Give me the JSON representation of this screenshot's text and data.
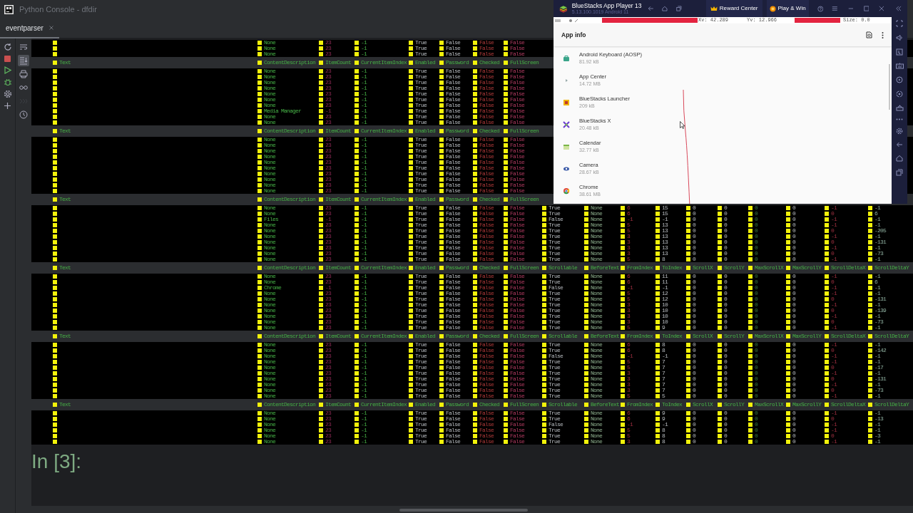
{
  "window": {
    "title": "Python Console - dfdir"
  },
  "tabs": [
    {
      "label": "eventparser",
      "selected": true
    }
  ],
  "console_toolbar": [
    {
      "kind": "wrap",
      "selected": false,
      "disabled": false
    },
    {
      "kind": "scroll-end",
      "selected": true,
      "disabled": false
    },
    {
      "kind": "print",
      "selected": false,
      "disabled": false
    },
    {
      "kind": "glasses",
      "selected": false,
      "disabled": false
    },
    {
      "kind": "history",
      "selected": false,
      "disabled": true
    },
    {
      "kind": "clock",
      "selected": false,
      "disabled": false
    }
  ],
  "console": {
    "blocks": [
      {
        "rows": [
          [
            "",
            "None",
            "23",
            "-1",
            "True",
            "False",
            "False",
            "False"
          ],
          [
            "",
            "None",
            "23",
            "-1",
            "True",
            "False",
            "False",
            "False"
          ],
          [
            "",
            "None",
            "23",
            "-1",
            "True",
            "False",
            "False",
            "False"
          ]
        ]
      },
      {
        "columns": [
          "Text",
          "ContentDescription",
          "ItemCount",
          "CurrentItemIndex",
          "Enabled",
          "Password",
          "Checked",
          "FullScreen"
        ],
        "rows": [
          [
            "",
            "None",
            "23",
            "-1",
            "True",
            "False",
            "False",
            "False"
          ],
          [
            "",
            "None",
            "23",
            "-1",
            "True",
            "False",
            "False",
            "False"
          ],
          [
            "",
            "None",
            "23",
            "-1",
            "True",
            "False",
            "False",
            "False"
          ],
          [
            "",
            "None",
            "23",
            "-1",
            "True",
            "False",
            "False",
            "False"
          ],
          [
            "",
            "None",
            "23",
            "-1",
            "True",
            "False",
            "False",
            "False"
          ],
          [
            "",
            "None",
            "23",
            "-1",
            "True",
            "False",
            "False",
            "False"
          ],
          [
            "",
            "None",
            "23",
            "-1",
            "True",
            "False",
            "False",
            "False"
          ],
          [
            "",
            "Media Manager",
            "-1",
            "-1",
            "True",
            "False",
            "False",
            "False"
          ],
          [
            "",
            "None",
            "23",
            "-1",
            "True",
            "False",
            "False",
            "False"
          ],
          [
            "",
            "None",
            "23",
            "-1",
            "True",
            "False",
            "False",
            "False"
          ]
        ]
      },
      {
        "columns": [
          "Text",
          "ContentDescription",
          "ItemCount",
          "CurrentItemIndex",
          "Enabled",
          "Password",
          "Checked",
          "FullScreen"
        ],
        "rows": [
          [
            "",
            "None",
            "23",
            "-1",
            "True",
            "False",
            "False",
            "False"
          ],
          [
            "",
            "None",
            "23",
            "-1",
            "True",
            "False",
            "False",
            "False"
          ],
          [
            "",
            "None",
            "23",
            "-1",
            "True",
            "False",
            "False",
            "False"
          ],
          [
            "",
            "None",
            "23",
            "-1",
            "True",
            "False",
            "False",
            "False"
          ],
          [
            "",
            "None",
            "23",
            "-1",
            "True",
            "False",
            "False",
            "False"
          ],
          [
            "",
            "None",
            "23",
            "-1",
            "True",
            "False",
            "False",
            "False"
          ],
          [
            "",
            "None",
            "23",
            "-1",
            "True",
            "False",
            "False",
            "False"
          ],
          [
            "",
            "None",
            "23",
            "-1",
            "True",
            "False",
            "False",
            "False"
          ],
          [
            "",
            "None",
            "23",
            "-1",
            "True",
            "False",
            "False",
            "False"
          ],
          [
            "",
            "None",
            "23",
            "-1",
            "True",
            "False",
            "False",
            "False"
          ]
        ]
      },
      {
        "columns": [
          "Text",
          "ContentDescription",
          "ItemCount",
          "CurrentItemIndex",
          "Enabled",
          "Password",
          "Checked",
          "FullScreen"
        ],
        "rows": [
          [
            "",
            "None",
            "23",
            "-1",
            "True",
            "False",
            "False",
            "False",
            "True",
            "None",
            "6",
            "15",
            "0",
            "0",
            "0",
            "0",
            "-1",
            "-1"
          ],
          [
            "",
            "None",
            "23",
            "-1",
            "True",
            "False",
            "False",
            "False",
            "True",
            "None",
            "6",
            "15",
            "0",
            "0",
            "0",
            "0",
            "0",
            "6"
          ],
          [
            "",
            "Files",
            "-1",
            "-1",
            "True",
            "False",
            "False",
            "False",
            "False",
            "None",
            "-1",
            "-1",
            "0",
            "0",
            "0",
            "0",
            "-1",
            "-1"
          ],
          [
            "",
            "None",
            "23",
            "-1",
            "True",
            "False",
            "False",
            "False",
            "True",
            "None",
            "5",
            "13",
            "0",
            "0",
            "0",
            "0",
            "-1",
            "-1"
          ],
          [
            "",
            "None",
            "23",
            "-1",
            "True",
            "False",
            "False",
            "False",
            "True",
            "None",
            "5",
            "13",
            "0",
            "0",
            "0",
            "0",
            "0",
            "-205"
          ],
          [
            "",
            "None",
            "23",
            "-1",
            "True",
            "False",
            "False",
            "False",
            "True",
            "None",
            "3",
            "13",
            "0",
            "0",
            "0",
            "0",
            "-1",
            "-1"
          ],
          [
            "",
            "None",
            "23",
            "-1",
            "True",
            "False",
            "False",
            "False",
            "True",
            "None",
            "3",
            "13",
            "0",
            "0",
            "0",
            "0",
            "0",
            "-131"
          ],
          [
            "",
            "None",
            "23",
            "-1",
            "True",
            "False",
            "False",
            "False",
            "True",
            "None",
            "3",
            "13",
            "0",
            "0",
            "0",
            "0",
            "-1",
            "-1"
          ],
          [
            "",
            "None",
            "23",
            "-1",
            "True",
            "False",
            "False",
            "False",
            "True",
            "None",
            "3",
            "13",
            "0",
            "0",
            "0",
            "0",
            "0",
            "-73"
          ],
          [
            "",
            "None",
            "23",
            "-1",
            "True",
            "False",
            "False",
            "False",
            "True",
            "None",
            "5",
            "8",
            "0",
            "0",
            "0",
            "0",
            "-1",
            "-1"
          ]
        ]
      },
      {
        "columns": [
          "Text",
          "ContentDescription",
          "ItemCount",
          "CurrentItemIndex",
          "Enabled",
          "Password",
          "Checked",
          "FullScreen",
          "Scrollable",
          "BeforeText",
          "FromIndex",
          "ToIndex",
          "ScrollX",
          "ScrollY",
          "MaxScrollX",
          "MaxScrollY",
          "ScrollDeltaX",
          "ScrollDeltaY"
        ],
        "rows": [
          [
            "",
            "None",
            "23",
            "-1",
            "True",
            "False",
            "False",
            "False",
            "True",
            "None",
            "6",
            "11",
            "0",
            "0",
            "0",
            "0",
            "-1",
            "-1"
          ],
          [
            "",
            "None",
            "23",
            "-1",
            "True",
            "False",
            "False",
            "False",
            "True",
            "None",
            "6",
            "11",
            "0",
            "0",
            "0",
            "0",
            "0",
            "6"
          ],
          [
            "",
            "Chrome",
            "-1",
            "-1",
            "True",
            "False",
            "False",
            "False",
            "False",
            "None",
            "-1",
            "-1",
            "0",
            "0",
            "0",
            "0",
            "-1",
            "-1"
          ],
          [
            "",
            "None",
            "23",
            "-1",
            "True",
            "False",
            "False",
            "False",
            "True",
            "None",
            "5",
            "12",
            "0",
            "0",
            "0",
            "0",
            "-1",
            "-1"
          ],
          [
            "",
            "None",
            "23",
            "-1",
            "True",
            "False",
            "False",
            "False",
            "True",
            "None",
            "5",
            "12",
            "0",
            "0",
            "0",
            "0",
            "0",
            "-131"
          ],
          [
            "",
            "None",
            "23",
            "-1",
            "True",
            "False",
            "False",
            "False",
            "True",
            "None",
            "3",
            "10",
            "0",
            "0",
            "0",
            "0",
            "-1",
            "-1"
          ],
          [
            "",
            "None",
            "23",
            "-1",
            "True",
            "False",
            "False",
            "False",
            "True",
            "None",
            "3",
            "10",
            "0",
            "0",
            "0",
            "0",
            "0",
            "-139"
          ],
          [
            "",
            "None",
            "23",
            "-1",
            "True",
            "False",
            "False",
            "False",
            "True",
            "None",
            "3",
            "10",
            "0",
            "0",
            "0",
            "0",
            "-1",
            "-1"
          ],
          [
            "",
            "None",
            "23",
            "-1",
            "True",
            "False",
            "False",
            "False",
            "True",
            "None",
            "3",
            "10",
            "0",
            "0",
            "0",
            "0",
            "0",
            "-73"
          ],
          [
            "",
            "None",
            "23",
            "-1",
            "True",
            "False",
            "False",
            "False",
            "True",
            "None",
            "5",
            "9",
            "0",
            "0",
            "0",
            "0",
            "-1",
            "-1"
          ]
        ]
      },
      {
        "columns": [
          "Text",
          "ContentDescription",
          "ItemCount",
          "CurrentItemIndex",
          "Enabled",
          "Password",
          "Checked",
          "FullScreen",
          "Scrollable",
          "BeforeText",
          "FromIndex",
          "ToIndex",
          "ScrollX",
          "ScrollY",
          "MaxScrollX",
          "MaxScrollY",
          "ScrollDeltaX",
          "ScrollDeltaY"
        ],
        "rows": [
          [
            "",
            "None",
            "23",
            "-1",
            "True",
            "False",
            "False",
            "False",
            "True",
            "None",
            "6",
            "8",
            "0",
            "0",
            "0",
            "0",
            "-1",
            "-1"
          ],
          [
            "",
            "None",
            "23",
            "-1",
            "True",
            "False",
            "False",
            "False",
            "True",
            "None",
            "6",
            "8",
            "0",
            "0",
            "0",
            "0",
            "0",
            "-142"
          ],
          [
            "",
            "None",
            "23",
            "-1",
            "True",
            "False",
            "False",
            "False",
            "False",
            "None",
            "-1",
            "-1",
            "0",
            "0",
            "0",
            "0",
            "-1",
            "-1"
          ],
          [
            "",
            "None",
            "23",
            "-1",
            "True",
            "False",
            "False",
            "False",
            "True",
            "None",
            "5",
            "7",
            "0",
            "0",
            "0",
            "0",
            "-1",
            "-1"
          ],
          [
            "",
            "None",
            "23",
            "-1",
            "True",
            "False",
            "False",
            "False",
            "True",
            "None",
            "5",
            "7",
            "0",
            "0",
            "0",
            "0",
            "0",
            "-17"
          ],
          [
            "",
            "None",
            "23",
            "-1",
            "True",
            "False",
            "False",
            "False",
            "True",
            "None",
            "3",
            "7",
            "0",
            "0",
            "0",
            "0",
            "-1",
            "-1"
          ],
          [
            "",
            "None",
            "23",
            "-1",
            "True",
            "False",
            "False",
            "False",
            "True",
            "None",
            "3",
            "7",
            "0",
            "0",
            "0",
            "0",
            "0",
            "-131"
          ],
          [
            "",
            "None",
            "23",
            "-1",
            "True",
            "False",
            "False",
            "False",
            "True",
            "None",
            "3",
            "7",
            "0",
            "0",
            "0",
            "0",
            "-1",
            "-1"
          ],
          [
            "",
            "None",
            "23",
            "-1",
            "True",
            "False",
            "False",
            "False",
            "True",
            "None",
            "3",
            "7",
            "0",
            "0",
            "0",
            "0",
            "0",
            "-73"
          ],
          [
            "",
            "None",
            "23",
            "-1",
            "True",
            "False",
            "False",
            "False",
            "True",
            "None",
            "5",
            "5",
            "0",
            "0",
            "0",
            "0",
            "-1",
            "-1"
          ]
        ]
      },
      {
        "columns": [
          "Text",
          "ContentDescription",
          "ItemCount",
          "CurrentItemIndex",
          "Enabled",
          "Password",
          "Checked",
          "FullScreen",
          "Scrollable",
          "BeforeText",
          "FromIndex",
          "ToIndex",
          "ScrollX",
          "ScrollY",
          "MaxScrollX",
          "MaxScrollY",
          "ScrollDeltaX",
          "ScrollDeltaY"
        ],
        "rows": [
          [
            "",
            "None",
            "23",
            "-1",
            "True",
            "False",
            "False",
            "False",
            "True",
            "None",
            "6",
            "9",
            "0",
            "0",
            "0",
            "0",
            "-1",
            "-1"
          ],
          [
            "",
            "None",
            "23",
            "-1",
            "True",
            "False",
            "False",
            "False",
            "True",
            "None",
            "6",
            "9",
            "0",
            "0",
            "0",
            "0",
            "0",
            "-13"
          ],
          [
            "",
            "None",
            "23",
            "-1",
            "True",
            "False",
            "False",
            "False",
            "False",
            "None",
            "-1",
            "-1",
            "0",
            "0",
            "0",
            "0",
            "-1",
            "-1"
          ],
          [
            "",
            "None",
            "23",
            "-1",
            "True",
            "False",
            "False",
            "False",
            "True",
            "None",
            "5",
            "8",
            "0",
            "0",
            "0",
            "0",
            "-1",
            "-1"
          ],
          [
            "",
            "None",
            "23",
            "-1",
            "True",
            "False",
            "False",
            "False",
            "True",
            "None",
            "5",
            "8",
            "0",
            "0",
            "0",
            "0",
            "0",
            "-3"
          ],
          [
            "",
            "None",
            "23",
            "-1",
            "True",
            "False",
            "False",
            "False",
            "True",
            "None",
            "3",
            "8",
            "0",
            "0",
            "0",
            "0",
            "-1",
            "-1"
          ]
        ]
      }
    ],
    "prompt": "In [3]:"
  },
  "emulator": {
    "title": "BlueStacks App Player 13",
    "version": "5.13.100.1019 Android 11",
    "reward_button": "Reward Center",
    "play_button": "Play & Win",
    "status_strip": [
      "Xv: 42.289",
      "Yv: 12.966",
      "Size: 0.0"
    ],
    "app_bar_title": "App info",
    "apps": [
      {
        "name": "Android Keyboard (AOSP)",
        "size": "81.92 kB"
      },
      {
        "name": "App Center",
        "size": "14.72 MB"
      },
      {
        "name": "BlueStacks Launcher",
        "size": "209 kB"
      },
      {
        "name": "BlueStacks X",
        "size": "20.48 kB"
      },
      {
        "name": "Calendar",
        "size": "32.77 kB"
      },
      {
        "name": "Camera",
        "size": "28.67 kB"
      },
      {
        "name": "Chrome",
        "size": "38.61 MB"
      }
    ]
  }
}
